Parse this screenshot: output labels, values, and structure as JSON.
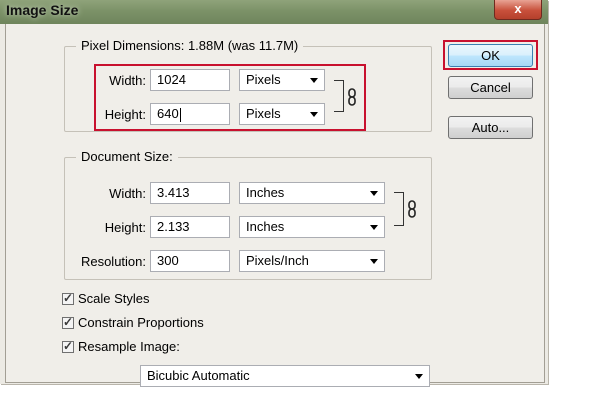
{
  "window": {
    "title": "Image Size",
    "close_glyph": "x"
  },
  "pixel_dimensions": {
    "label": "Pixel Dimensions:",
    "value": "1.88M (was 11.7M)",
    "width": {
      "label": "Width:",
      "value": "1024",
      "unit": "Pixels"
    },
    "height": {
      "label": "Height:",
      "value": "640",
      "unit": "Pixels"
    }
  },
  "document_size": {
    "label": "Document Size:",
    "width": {
      "label": "Width:",
      "value": "3.413",
      "unit": "Inches"
    },
    "height": {
      "label": "Height:",
      "value": "2.133",
      "unit": "Inches"
    },
    "resolution": {
      "label": "Resolution:",
      "value": "300",
      "unit": "Pixels/Inch"
    }
  },
  "options": {
    "scale_styles": {
      "label": "Scale Styles",
      "checked": true
    },
    "constrain_proportions": {
      "label": "Constrain Proportions",
      "checked": true
    },
    "resample_image": {
      "label": "Resample Image:",
      "checked": true
    },
    "resample_method": "Bicubic Automatic"
  },
  "buttons": {
    "ok": "OK",
    "cancel": "Cancel",
    "auto": "Auto..."
  },
  "colors": {
    "highlight": "#c8102e",
    "default_button": "#bee6fd"
  }
}
